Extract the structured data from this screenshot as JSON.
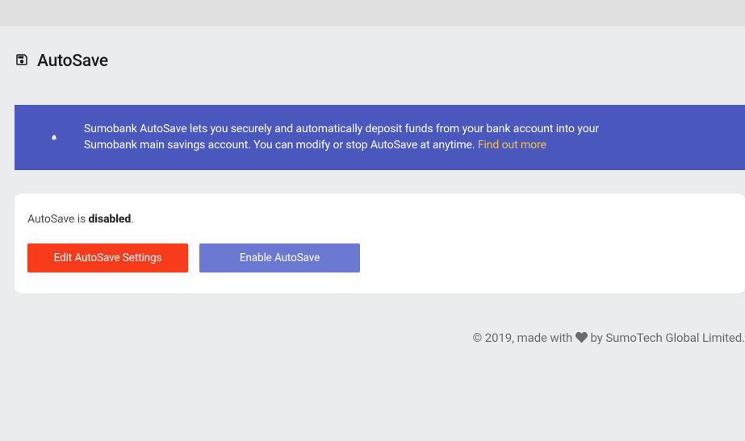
{
  "page": {
    "title": "AutoSave"
  },
  "banner": {
    "text_part1": "Sumobank AutoSave lets you securely and automatically deposit funds from your bank account into your Sumobank main savings account. You can modify or stop AutoSave at anytime. ",
    "link_text": "Find out more"
  },
  "status": {
    "prefix": "AutoSave is ",
    "state": "disabled",
    "suffix": "."
  },
  "buttons": {
    "edit": "Edit AutoSave Settings",
    "enable": "Enable AutoSave"
  },
  "footer": {
    "part1": "© 2019, made with ",
    "part2": " by SumoTech Global Limited."
  }
}
